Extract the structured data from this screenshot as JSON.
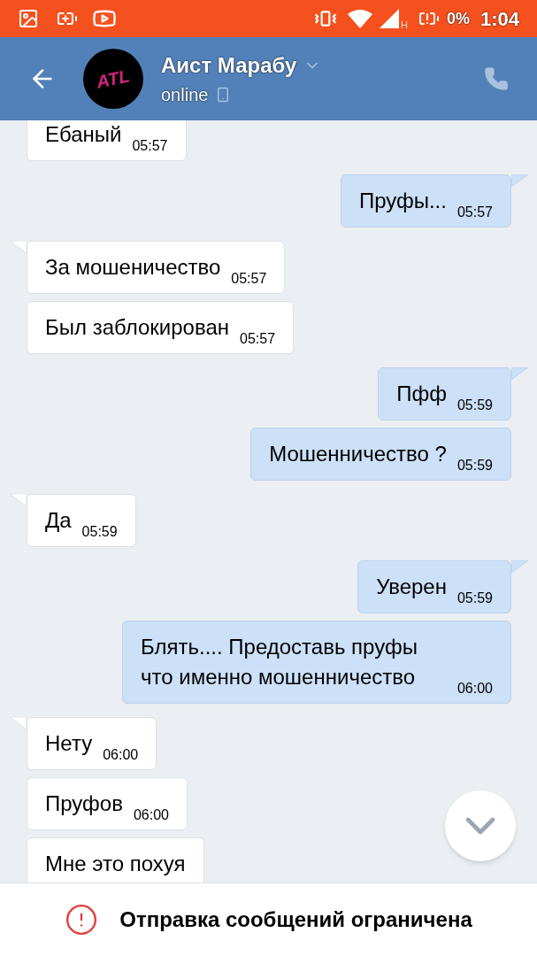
{
  "status_bar": {
    "network": "H",
    "battery": "0%",
    "time": "1:04"
  },
  "header": {
    "avatar_text": "ATL",
    "name": "Аист Марабу",
    "status": "online"
  },
  "groups": [
    {
      "kind": "incoming",
      "tail": false,
      "messages": [
        {
          "text": "Ебаный",
          "time": "05:57"
        }
      ]
    },
    {
      "kind": "outgoing",
      "tail": true,
      "messages": [
        {
          "text": "Пруфы...",
          "time": "05:57"
        }
      ]
    },
    {
      "kind": "incoming",
      "tail": true,
      "messages": [
        {
          "text": "За мошеничество",
          "time": "05:57"
        },
        {
          "text": "Был заблокирован",
          "time": "05:57"
        }
      ]
    },
    {
      "kind": "outgoing",
      "tail": true,
      "messages": [
        {
          "text": "Пфф",
          "time": "05:59"
        },
        {
          "text": "Мошенничество ?",
          "time": "05:59"
        }
      ]
    },
    {
      "kind": "incoming",
      "tail": true,
      "messages": [
        {
          "text": "Да",
          "time": "05:59"
        }
      ]
    },
    {
      "kind": "outgoing",
      "tail": true,
      "messages": [
        {
          "text": "Уверен",
          "time": "05:59"
        },
        {
          "text": "Блять.... Предоставь пруфы что именно мошенничество",
          "time": "06:00"
        }
      ]
    },
    {
      "kind": "incoming",
      "tail": true,
      "messages": [
        {
          "text": "Нету",
          "time": "06:00"
        },
        {
          "text": "Пруфов",
          "time": "06:00"
        },
        {
          "text": "Мне это похуя"
        }
      ]
    }
  ],
  "notice": "Отправка сообщений ограничена"
}
